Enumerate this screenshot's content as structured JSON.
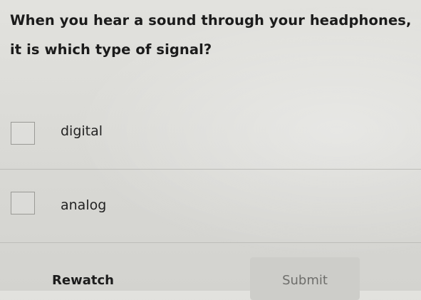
{
  "question": {
    "text": "When you hear a sound through your headphones, it is which type of signal?"
  },
  "options": [
    {
      "label": "digital",
      "checked": false
    },
    {
      "label": "analog",
      "checked": false
    }
  ],
  "actions": {
    "rewatch_label": "Rewatch",
    "submit_label": "Submit"
  }
}
